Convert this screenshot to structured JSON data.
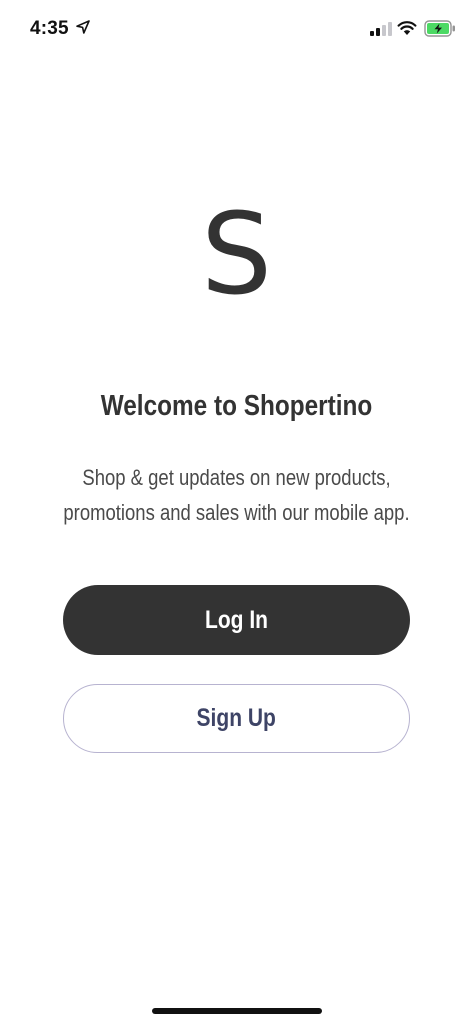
{
  "status_bar": {
    "time": "4:35",
    "icons": [
      "location-arrow-icon",
      "cellular-signal-icon",
      "wifi-icon",
      "battery-charging-icon"
    ],
    "battery_color": "#4cd964"
  },
  "logo": {
    "letter": "S"
  },
  "welcome": {
    "title": "Welcome to Shopertino",
    "subtitle_line1": "Shop & get updates on new products,",
    "subtitle_line2": "promotions and sales with our mobile app."
  },
  "actions": {
    "login_label": "Log In",
    "signup_label": "Sign Up"
  },
  "colors": {
    "primary_dark": "#333333",
    "signup_text": "#3e4466",
    "signup_border": "#b7b3d0",
    "background": "#ffffff"
  }
}
